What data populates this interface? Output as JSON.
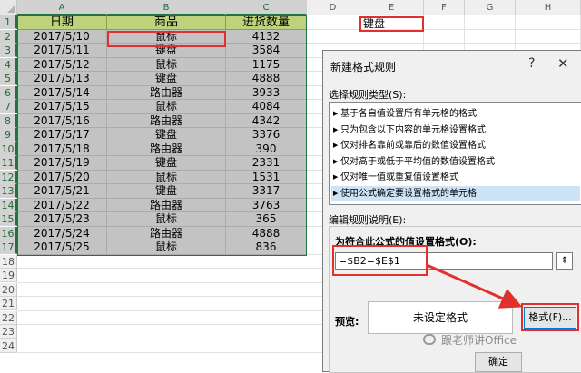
{
  "columns": [
    "A",
    "B",
    "C",
    "D",
    "E",
    "F",
    "G",
    "H"
  ],
  "rows": [
    "1",
    "2",
    "3",
    "4",
    "5",
    "6",
    "7",
    "8",
    "9",
    "10",
    "11",
    "12",
    "13",
    "14",
    "15",
    "16",
    "17",
    "18",
    "19",
    "20",
    "21",
    "22",
    "23",
    "24"
  ],
  "table": {
    "headers": [
      "日期",
      "商品",
      "进货数量"
    ],
    "data": [
      [
        "2017/5/10",
        "鼠标",
        "4132"
      ],
      [
        "2017/5/11",
        "键盘",
        "3584"
      ],
      [
        "2017/5/12",
        "鼠标",
        "1175"
      ],
      [
        "2017/5/13",
        "键盘",
        "4888"
      ],
      [
        "2017/5/14",
        "路由器",
        "3933"
      ],
      [
        "2017/5/15",
        "鼠标",
        "4084"
      ],
      [
        "2017/5/16",
        "路由器",
        "4342"
      ],
      [
        "2017/5/17",
        "键盘",
        "3376"
      ],
      [
        "2017/5/18",
        "路由器",
        "390"
      ],
      [
        "2017/5/19",
        "键盘",
        "2331"
      ],
      [
        "2017/5/20",
        "鼠标",
        "1531"
      ],
      [
        "2017/5/21",
        "键盘",
        "3317"
      ],
      [
        "2017/5/22",
        "路由器",
        "3763"
      ],
      [
        "2017/5/23",
        "鼠标",
        "365"
      ],
      [
        "2017/5/24",
        "路由器",
        "4888"
      ],
      [
        "2017/5/25",
        "鼠标",
        "836"
      ]
    ]
  },
  "e1_value": "键盘",
  "dialog": {
    "title": "新建格式规则",
    "help": "?",
    "close": "✕",
    "rule_type_label": "选择规则类型(S):",
    "rule_types": [
      "基于各自值设置所有单元格的格式",
      "只为包含以下内容的单元格设置格式",
      "仅对排名靠前或靠后的数值设置格式",
      "仅对高于或低于平均值的数值设置格式",
      "仅对唯一值或重复值设置格式",
      "使用公式确定要设置格式的单元格"
    ],
    "edit_label": "编辑规则说明(E):",
    "formula_label": "为符合此公式的值设置格式(O):",
    "formula_value": "=$B2=$E$1",
    "preview_label": "预览:",
    "preview_text": "未设定格式",
    "format_button": "格式(F)...",
    "ok_button": "确定"
  },
  "watermark": "跟老师讲Office",
  "colors": {
    "header_fill": "#bcd27c",
    "selection_fill": "#c3c3c3",
    "highlight": "#e0312e",
    "excel_green": "#217346"
  }
}
